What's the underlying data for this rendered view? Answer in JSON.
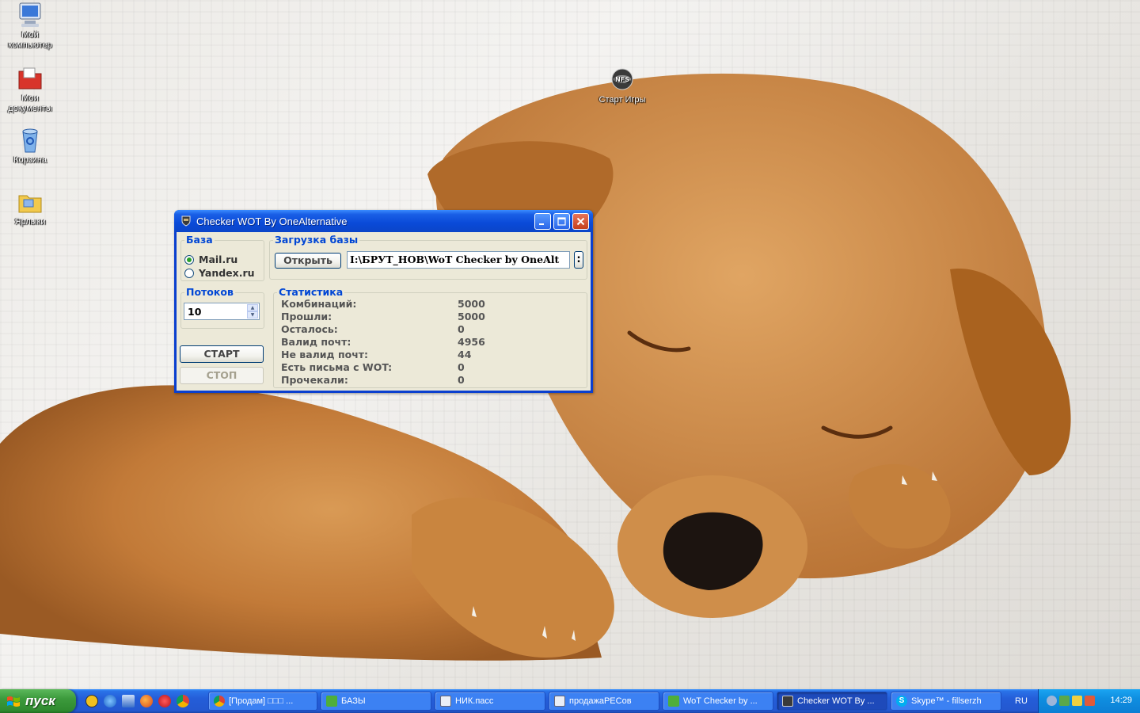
{
  "desktop": {
    "icons": [
      {
        "label_line1": "Мой",
        "label_line2": "компьютер"
      },
      {
        "label_line1": "Мои",
        "label_line2": "документы"
      },
      {
        "label_line1": "Корзина",
        "label_line2": ""
      },
      {
        "label_line1": "Ярлыки",
        "label_line2": ""
      },
      {
        "label_line1": "Старт Игры",
        "label_line2": ""
      }
    ]
  },
  "window": {
    "title": "Checker WOT By OneAlternative",
    "base_group": {
      "legend": "База",
      "options": [
        "Mail.ru",
        "Yandex.ru"
      ],
      "selected": "Mail.ru"
    },
    "threads_group": {
      "legend": "Потоков",
      "value": "10"
    },
    "start_button": "СТАРТ",
    "stop_button": "СТОП",
    "load_group": {
      "legend": "Загрузка базы",
      "open_button": "Открыть",
      "path": "I:\\БРУТ_НОВ\\WoT Checker by OneAlt",
      "extra_button": ":"
    },
    "stats_group": {
      "legend": "Статистика",
      "rows": [
        {
          "label": "Комбинаций:",
          "value": "5000"
        },
        {
          "label": "Прошли:",
          "value": "5000"
        },
        {
          "label": "Осталось:",
          "value": "0"
        },
        {
          "label": "Валид почт:",
          "value": "4956"
        },
        {
          "label": "Не валид почт:",
          "value": "44"
        },
        {
          "label": "Есть письма с WOT:",
          "value": "0"
        },
        {
          "label": "Прочекали:",
          "value": "0"
        }
      ]
    }
  },
  "taskbar": {
    "start_label": "пуск",
    "items": [
      {
        "label": "[Продам] □□□ ...",
        "icon": "chrome-icon"
      },
      {
        "label": "БАЗЫ",
        "icon": "app-icon"
      },
      {
        "label": "НИК.пасс",
        "icon": "notepad-icon"
      },
      {
        "label": "продажаРЕСов",
        "icon": "notepad-icon"
      },
      {
        "label": "WoT Checker by ...",
        "icon": "app-icon"
      },
      {
        "label": "Checker WOT By ...",
        "icon": "wot-icon"
      },
      {
        "label": "Skype™ - fillserzh",
        "icon": "skype-icon"
      }
    ],
    "language": "RU",
    "clock": "14:29"
  }
}
